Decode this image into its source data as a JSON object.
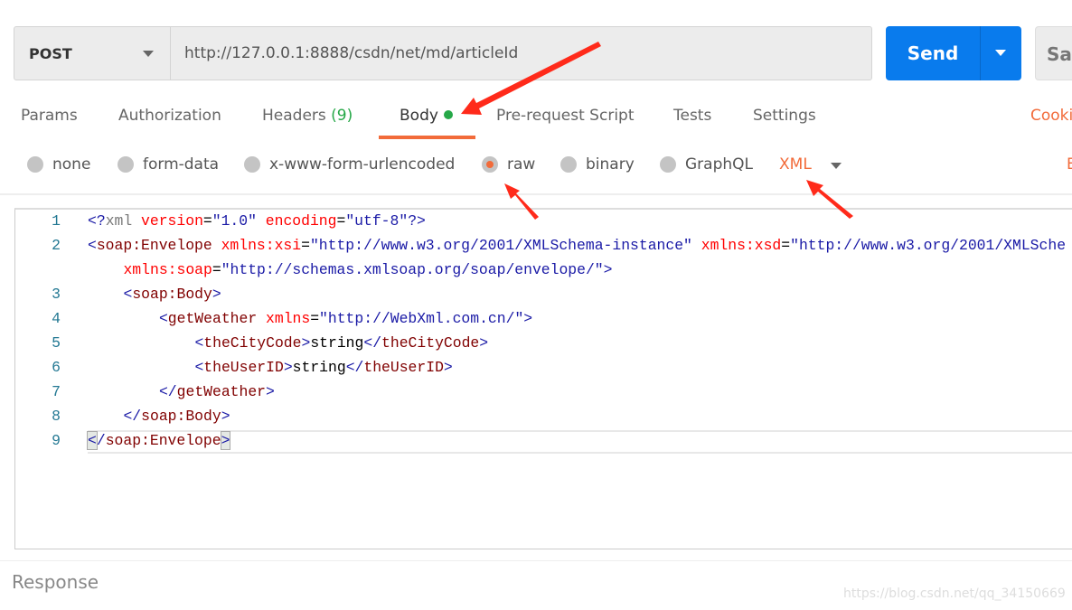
{
  "request": {
    "method": "POST",
    "url": "http://127.0.0.1:8888/csdn/net/md/articleId",
    "send_label": "Send",
    "save_label": "Sav"
  },
  "tabs": [
    {
      "label": "Params"
    },
    {
      "label": "Authorization"
    },
    {
      "label": "Headers",
      "count": "(9)"
    },
    {
      "label": "Body",
      "active": true
    },
    {
      "label": "Pre-request Script"
    },
    {
      "label": "Tests"
    },
    {
      "label": "Settings"
    }
  ],
  "cookies_label": "Cooki",
  "body_types": [
    {
      "label": "none"
    },
    {
      "label": "form-data"
    },
    {
      "label": "x-www-form-urlencoded"
    },
    {
      "label": "raw",
      "selected": true
    },
    {
      "label": "binary"
    },
    {
      "label": "GraphQL"
    }
  ],
  "language": "XML",
  "beautify_label": "B",
  "editor": {
    "lines": [
      {
        "n": "1",
        "indent": 0,
        "tokens": [
          [
            "b",
            "<?"
          ],
          [
            "p",
            "xml"
          ],
          [
            "x",
            " "
          ],
          [
            "a",
            "version"
          ],
          [
            "x",
            "="
          ],
          [
            "s",
            "\"1.0\""
          ],
          [
            "x",
            " "
          ],
          [
            "a",
            "encoding"
          ],
          [
            "x",
            "="
          ],
          [
            "s",
            "\"utf-8\""
          ],
          [
            "b",
            "?>"
          ]
        ]
      },
      {
        "n": "2",
        "indent": 0,
        "tokens": [
          [
            "b",
            "<"
          ],
          [
            "n",
            "soap:Envelope"
          ],
          [
            "x",
            " "
          ],
          [
            "a",
            "xmlns:xsi"
          ],
          [
            "x",
            "="
          ],
          [
            "s",
            "\"http://www.w3.org/2001/XMLSchema-instance\""
          ],
          [
            "x",
            " "
          ],
          [
            "a",
            "xmlns:xsd"
          ],
          [
            "x",
            "="
          ],
          [
            "s",
            "\"http://www.w3.org/2001/XMLSche"
          ]
        ]
      },
      {
        "n": "",
        "indent": 4,
        "tokens": [
          [
            "a",
            "xmlns:soap"
          ],
          [
            "x",
            "="
          ],
          [
            "s",
            "\"http://schemas.xmlsoap.org/soap/envelope/\""
          ],
          [
            "b",
            ">"
          ]
        ]
      },
      {
        "n": "3",
        "indent": 4,
        "tokens": [
          [
            "b",
            "<"
          ],
          [
            "n",
            "soap:Body"
          ],
          [
            "b",
            ">"
          ]
        ]
      },
      {
        "n": "4",
        "indent": 8,
        "tokens": [
          [
            "b",
            "<"
          ],
          [
            "n",
            "getWeather"
          ],
          [
            "x",
            " "
          ],
          [
            "a",
            "xmlns"
          ],
          [
            "x",
            "="
          ],
          [
            "s",
            "\"http://WebXml.com.cn/\""
          ],
          [
            "b",
            ">"
          ]
        ]
      },
      {
        "n": "5",
        "indent": 12,
        "tokens": [
          [
            "b",
            "<"
          ],
          [
            "n",
            "theCityCode"
          ],
          [
            "b",
            ">"
          ],
          [
            "x",
            "string"
          ],
          [
            "b",
            "</"
          ],
          [
            "n",
            "theCityCode"
          ],
          [
            "b",
            ">"
          ]
        ]
      },
      {
        "n": "6",
        "indent": 12,
        "tokens": [
          [
            "b",
            "<"
          ],
          [
            "n",
            "theUserID"
          ],
          [
            "b",
            ">"
          ],
          [
            "x",
            "string"
          ],
          [
            "b",
            "</"
          ],
          [
            "n",
            "theUserID"
          ],
          [
            "b",
            ">"
          ]
        ]
      },
      {
        "n": "7",
        "indent": 8,
        "tokens": [
          [
            "b",
            "</"
          ],
          [
            "n",
            "getWeather"
          ],
          [
            "b",
            ">"
          ]
        ]
      },
      {
        "n": "8",
        "indent": 4,
        "tokens": [
          [
            "b",
            "</"
          ],
          [
            "n",
            "soap:Body"
          ],
          [
            "b",
            ">"
          ]
        ]
      },
      {
        "n": "9",
        "indent": 0,
        "tokens": [
          [
            "bm",
            "<"
          ],
          [
            "b",
            "/"
          ],
          [
            "n",
            "soap:Envelope"
          ],
          [
            "bm",
            ">"
          ]
        ]
      }
    ]
  },
  "response_label": "Response",
  "watermark": "https://blog.csdn.net/qq_34150669",
  "colors": {
    "accent": "#f26b3a",
    "send": "#097bed",
    "active_dot": "#26a848",
    "annotation_arrow": "#ff2a1a"
  }
}
